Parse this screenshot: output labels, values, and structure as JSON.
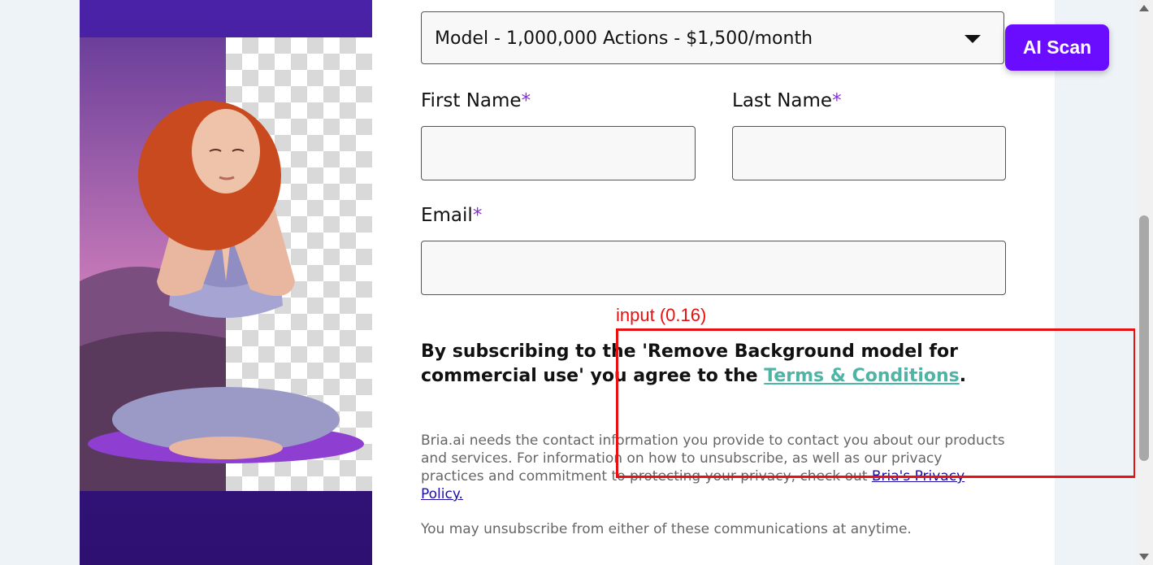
{
  "form": {
    "plan_select": {
      "value": "Model - 1,000,000 Actions - $1,500/month"
    },
    "first_name": {
      "label": "First Name",
      "required_mark": "*",
      "value": ""
    },
    "last_name": {
      "label": "Last Name",
      "required_mark": "*",
      "value": ""
    },
    "email": {
      "label": "Email",
      "required_mark": "*",
      "value": ""
    }
  },
  "agreement": {
    "text_before": "By subscribing to the 'Remove Background model for commercial use' you agree to the ",
    "link_text": "Terms & Conditions",
    "text_after": "."
  },
  "privacy": {
    "text": "Bria.ai needs the contact information you provide to contact you about our products and services. For information on how to unsubscribe, as well as our privacy practices and commitment to protecting your privacy, check out ",
    "link_text": "Bria's Privacy Policy."
  },
  "unsubscribe_text": "You may unsubscribe from either of these communications at anytime.",
  "ai_scan_button": {
    "label": "AI Scan",
    "color": "#6a0dff"
  },
  "detection_overlay": {
    "label": "input (0.16)",
    "color": "#e81010"
  },
  "hero_image": {
    "subject": "woman-meditating-background-removal"
  }
}
